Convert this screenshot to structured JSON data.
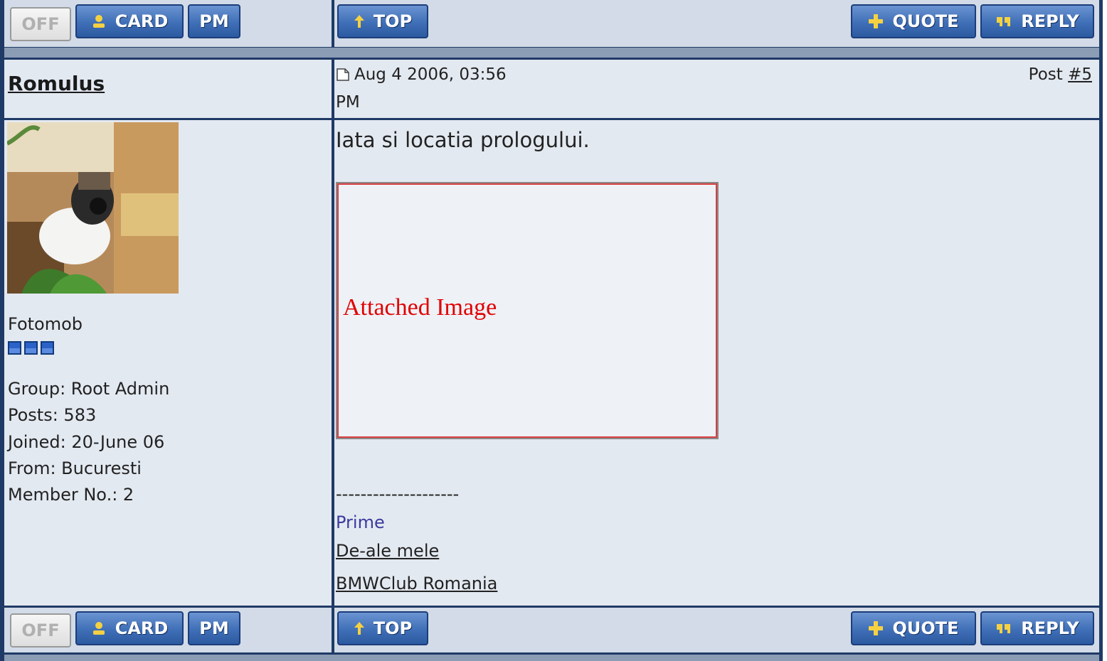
{
  "toolbar_top": {
    "off_label": "OFF",
    "card_label": "CARD",
    "pm_label": "PM",
    "top_label": "TOP",
    "quote_label": "QUOTE",
    "reply_label": "REPLY"
  },
  "toolbar_bottom": {
    "off_label": "OFF",
    "card_label": "CARD",
    "pm_label": "PM",
    "top_label": "TOP",
    "quote_label": "QUOTE",
    "reply_label": "REPLY"
  },
  "post": {
    "author": "Romulus",
    "date_line1": "Aug 4 2006, 03:56",
    "date_line2": "PM",
    "post_label": "Post",
    "post_number": "#5",
    "body": "Iata si locatia prologului.",
    "attachment_label": "Attached Image",
    "signature_rule": "--------------------",
    "signature_links": [
      "Prime",
      "De-ale mele",
      "BMWClub Romania"
    ]
  },
  "author_info": {
    "title": "Fotomob",
    "pips": 3,
    "group": "Group: Root Admin",
    "posts": "Posts: 583",
    "joined": "Joined: 20-June 06",
    "from": "From: Bucuresti",
    "member_no": "Member No.: 2"
  },
  "colors": {
    "frame": "#1f3a66",
    "panel": "#e3e9f1",
    "bar": "#8b9cb5",
    "button_blue": "#3f6fb7",
    "attachment_text": "#e00000",
    "prime_link": "#3b3b9e"
  }
}
